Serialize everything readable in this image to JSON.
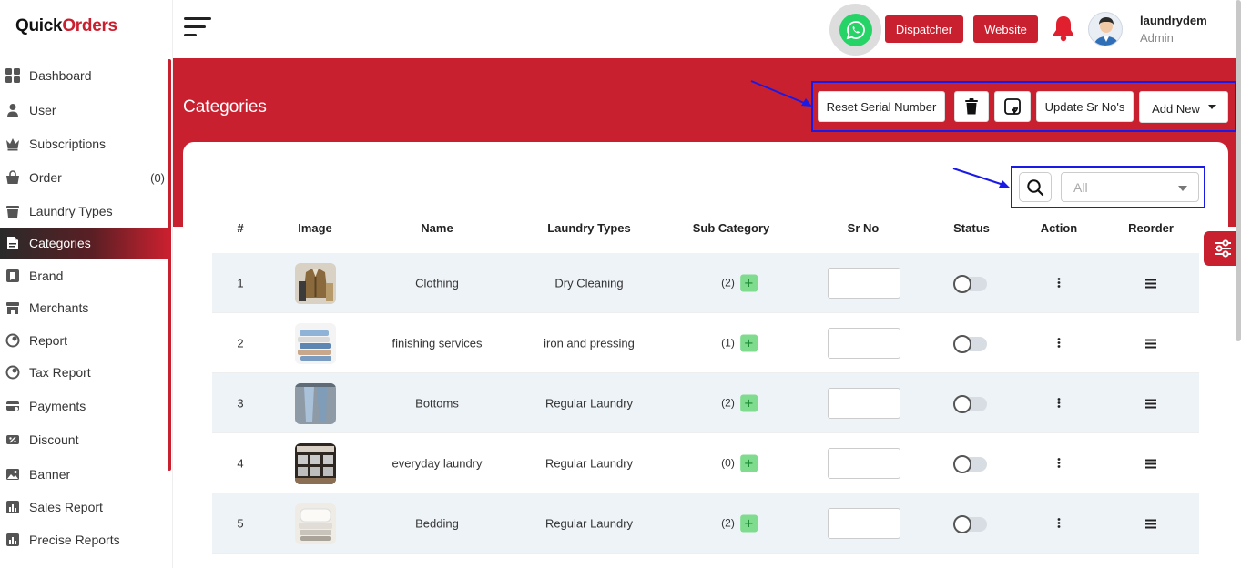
{
  "brand": {
    "logo_part1": "Quick",
    "logo_part2": "Orders"
  },
  "sidebar": {
    "items": [
      {
        "label": "Dashboard",
        "icon": "grid-icon"
      },
      {
        "label": "User",
        "icon": "user-icon"
      },
      {
        "label": "Subscriptions",
        "icon": "crown-icon"
      },
      {
        "label": "Order",
        "icon": "basket-icon",
        "count": "(0)"
      },
      {
        "label": "Laundry Types",
        "icon": "tub-icon"
      },
      {
        "label": "Categories",
        "icon": "file-icon",
        "active": true
      },
      {
        "label": "Brand",
        "icon": "brand-icon"
      },
      {
        "label": "Merchants",
        "icon": "store-icon"
      },
      {
        "label": "Report",
        "icon": "report-icon"
      },
      {
        "label": "Tax Report",
        "icon": "tax-report-icon"
      },
      {
        "label": "Payments",
        "icon": "payments-icon"
      },
      {
        "label": "Discount",
        "icon": "discount-icon"
      },
      {
        "label": "Banner",
        "icon": "image-icon"
      },
      {
        "label": "Sales Report",
        "icon": "chart-icon"
      },
      {
        "label": "Precise Reports",
        "icon": "chart-icon"
      }
    ]
  },
  "topbar": {
    "dispatcher_label": "Dispatcher",
    "website_label": "Website",
    "user_name": "laundrydem",
    "user_role": "Admin"
  },
  "page": {
    "title": "Categories",
    "reset_serial_label": "Reset Serial Number",
    "update_sr_label": "Update Sr No's",
    "add_new_label": "Add New",
    "filter_value": "All"
  },
  "table": {
    "headers": [
      "#",
      "Image",
      "Name",
      "Laundry Types",
      "Sub Category",
      "Sr No",
      "Status",
      "Action",
      "Reorder"
    ],
    "rows": [
      {
        "num": "1",
        "name": "Clothing",
        "laundry_type": "Dry Cleaning",
        "sub_count": "(2)",
        "thumb": "jacket"
      },
      {
        "num": "2",
        "name": "finishing services",
        "laundry_type": "iron and pressing",
        "sub_count": "(1)",
        "thumb": "folded"
      },
      {
        "num": "3",
        "name": "Bottoms",
        "laundry_type": "Regular Laundry",
        "sub_count": "(2)",
        "thumb": "jeans"
      },
      {
        "num": "4",
        "name": "everyday laundry",
        "laundry_type": "Regular Laundry",
        "sub_count": "(0)",
        "thumb": "shop"
      },
      {
        "num": "5",
        "name": "Bedding",
        "laundry_type": "Regular Laundry",
        "sub_count": "(2)",
        "thumb": "bed"
      }
    ]
  },
  "colors": {
    "accent": "#c8202f",
    "highlight": "#1a1ae6",
    "whatsapp": "#25d366"
  }
}
